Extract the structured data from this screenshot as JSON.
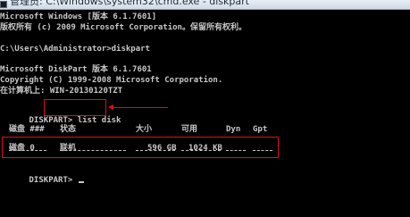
{
  "window": {
    "title": "管理员: C:\\Windows\\system32\\cmd.exe - diskpart"
  },
  "console": {
    "banner_lines": [
      "Microsoft Windows [版本 6.1.7601]",
      "版权所有 (c) 2009 Microsoft Corporation。保留所有权利。",
      "",
      "C:\\Users\\Administrator>diskpart",
      "",
      "Microsoft DiskPart 版本 6.1.7601",
      "Copyright (C) 1999-2008 Microsoft Corporation.",
      "在计算机上: WIN-20130120TZT"
    ],
    "prompt": "DISKPART> ",
    "command": "list disk",
    "table": {
      "headers": [
        "磁盘 ###",
        "状态",
        "大小",
        "可用",
        "Dyn",
        "Gpt"
      ],
      "rows": [
        [
          "磁盘 0",
          "联机",
          "596 GB",
          "1024 KB",
          "",
          ""
        ]
      ]
    },
    "final_prompt": "DISKPART> "
  },
  "colors": {
    "background": "#000000",
    "text": "#c8c8c8",
    "annotation": "#e01010"
  }
}
